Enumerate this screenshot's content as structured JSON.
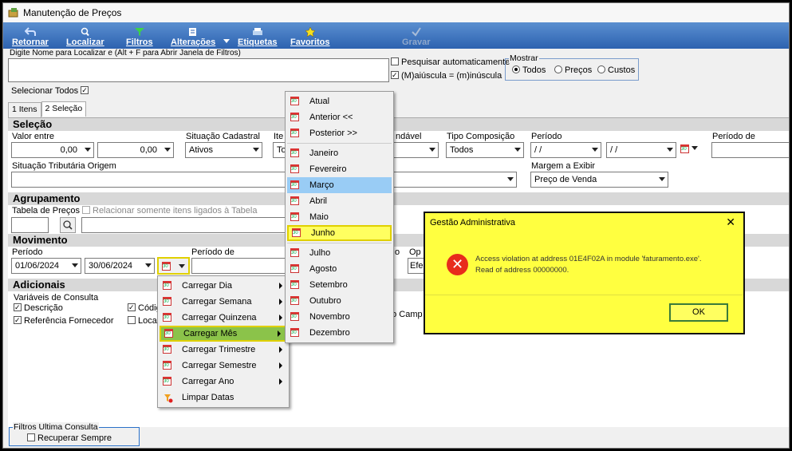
{
  "window": {
    "title": "Manutenção de Preços"
  },
  "toolbar": {
    "retornar": "Retornar",
    "localizar": "Localizar",
    "filtros": "Filtros",
    "alteracoes": "Alterações",
    "etiquetas": "Etiquetas",
    "favoritos": "Favoritos",
    "gravar": "Gravar"
  },
  "search": {
    "label": "Digite Nome para Localizar e (Alt + F para Abrir Janela de Filtros)",
    "value": "",
    "auto": "Pesquisar automaticamente",
    "case": "(M)aiúscula = (m)inúscula"
  },
  "mostrar": {
    "title": "Mostrar",
    "options": [
      "Todos",
      "Preços",
      "Custos"
    ]
  },
  "select_all": "Selecionar Todos",
  "tabs": [
    "1 Itens",
    "2 Seleção"
  ],
  "selecao": {
    "header": "Seleção",
    "valor_entre": "Valor entre",
    "valor_min": "0,00",
    "valor_max": "0,00",
    "situacao_cadastral": "Situação Cadastral",
    "situacao_cadastral_value": "Ativos",
    "item_label": "Ite",
    "item_value": "To",
    "vendavel_label": "ndável",
    "tipo_composicao": "Tipo Composição",
    "tipo_composicao_value": "Todos",
    "periodo": "Período",
    "periodo_ini": "/ /",
    "periodo_fim": "/ /",
    "periodo_de": "Período de",
    "situacao_tributaria": "Situação Tributária Origem",
    "margem_exibir": "Margem a Exibir",
    "margem_value": "Preço de Venda"
  },
  "agrupamento": {
    "header": "Agrupamento",
    "tabela_precos": "Tabela de Preços",
    "relacionar": "Relacionar somente itens ligados à Tabela"
  },
  "movimento": {
    "header": "Movimento",
    "periodo": "Período",
    "data_ini": "01/06/2024",
    "data_fim": "30/06/2024",
    "periodo_de": "Período de",
    "o_label": "o",
    "op_label": "Op",
    "op_value": "Efe"
  },
  "adicionais": {
    "header": "Adicionais",
    "variaveis": "Variáveis de Consulta",
    "descricao": "Descrição",
    "referencia": "Referência Fornecedor",
    "codigo": "Códig",
    "local": "Loca",
    "campo": "do Camp"
  },
  "filtros_ultima": {
    "title": "Filtros Ultima Consulta",
    "recuperar": "Recuperar Sempre"
  },
  "load_menu": {
    "items": [
      "Carregar Dia",
      "Carregar Semana",
      "Carregar Quinzena",
      "Carregar Mês",
      "Carregar Trimestre",
      "Carregar Semestre",
      "Carregar Ano",
      "Limpar Datas"
    ]
  },
  "month_menu": {
    "items": [
      "Atual",
      "Anterior <<",
      "Posterior >>",
      "Janeiro",
      "Fevereiro",
      "Março",
      "Abril",
      "Maio",
      "Junho",
      "Julho",
      "Agosto",
      "Setembro",
      "Outubro",
      "Novembro",
      "Dezembro"
    ]
  },
  "dialog": {
    "title": "Gestão Administrativa",
    "line1": "Access violation at address 01E4F02A in module 'faturamento.exe'.",
    "line2": "Read of address 00000000.",
    "ok": "OK"
  },
  "colors": {
    "toolbar": "#2d62b0",
    "highlight_yellow": "#ffff40",
    "menu_hover_blue": "#99ccf5",
    "menu_active_green": "#8bc34a",
    "error_red": "#e82c1c"
  }
}
